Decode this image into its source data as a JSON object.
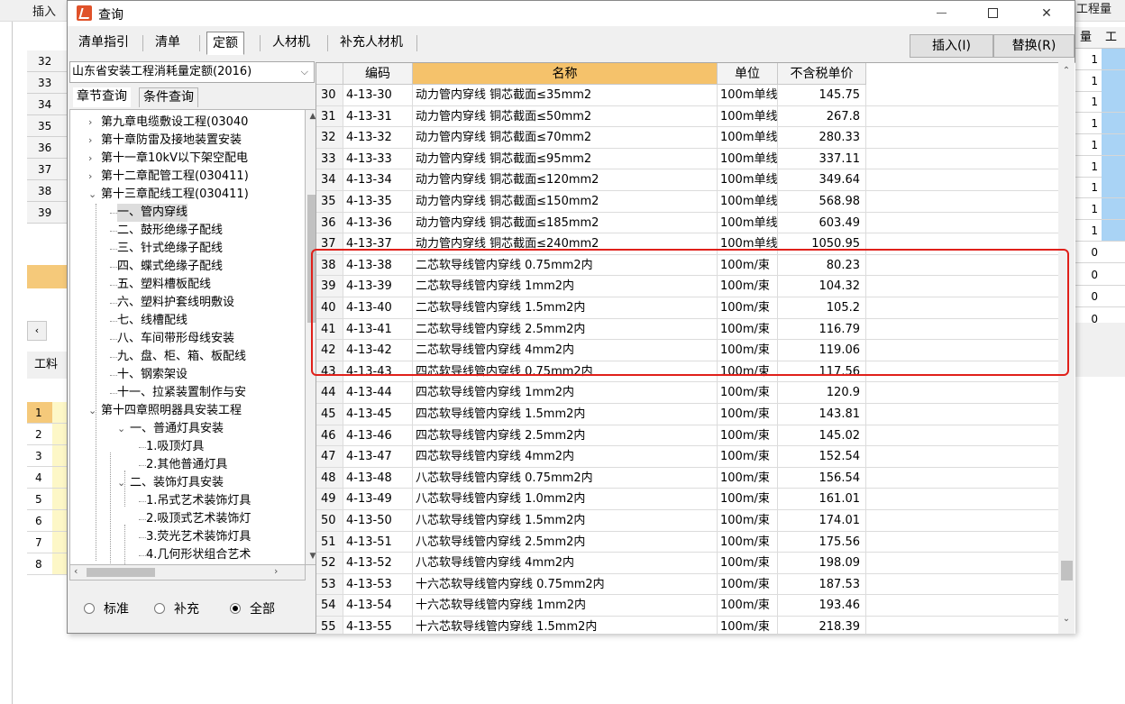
{
  "background": {
    "insert_label": "插入",
    "top_right_label": "工程量",
    "right_header": "工",
    "left_rows": [
      "32",
      "33",
      "34",
      "35",
      "36",
      "37",
      "38",
      "39"
    ],
    "gongliao_label": "工料",
    "lower_rows": [
      "1",
      "2",
      "3",
      "4",
      "5",
      "6",
      "7",
      "8"
    ],
    "right_values": [
      "1",
      "1",
      "1",
      "1",
      "1",
      "1",
      "1",
      "1",
      "1",
      "0",
      "0",
      "0",
      "0"
    ]
  },
  "dialog": {
    "title": "查询",
    "tabs": [
      "清单指引",
      "清单",
      "定额",
      "人材机",
      "补充人材机"
    ],
    "active_tab": "定额",
    "insert_button": "插入(I)",
    "replace_button": "替换(R)",
    "library_select": "山东省安装工程消耗量定额(2016)",
    "subtabs": [
      "章节查询",
      "条件查询"
    ],
    "tree": [
      {
        "label": "第九章电缆敷设工程(03040",
        "level": 1,
        "expand": "›"
      },
      {
        "label": "第十章防雷及接地装置安装",
        "level": 1,
        "expand": "›"
      },
      {
        "label": "第十一章10kV以下架空配电",
        "level": 1,
        "expand": "›"
      },
      {
        "label": "第十二章配管工程(030411)",
        "level": 1,
        "expand": "›"
      },
      {
        "label": "第十三章配线工程(030411)",
        "level": 1,
        "expand": "⌄"
      },
      {
        "label": "一、管内穿线",
        "level": 2,
        "expand": "",
        "selected": true
      },
      {
        "label": "二、鼓形绝缘子配线",
        "level": 2,
        "expand": ""
      },
      {
        "label": "三、针式绝缘子配线",
        "level": 2,
        "expand": ""
      },
      {
        "label": "四、蝶式绝缘子配线",
        "level": 2,
        "expand": ""
      },
      {
        "label": "五、塑料槽板配线",
        "level": 2,
        "expand": ""
      },
      {
        "label": "六、塑料护套线明敷设",
        "level": 2,
        "expand": ""
      },
      {
        "label": "七、线槽配线",
        "level": 2,
        "expand": ""
      },
      {
        "label": "八、车间带形母线安装",
        "level": 2,
        "expand": ""
      },
      {
        "label": "九、盘、柜、箱、板配线",
        "level": 2,
        "expand": ""
      },
      {
        "label": "十、钢索架设",
        "level": 2,
        "expand": ""
      },
      {
        "label": "十一、拉紧装置制作与安",
        "level": 2,
        "expand": ""
      },
      {
        "label": "第十四章照明器具安装工程",
        "level": 1,
        "expand": "⌄"
      },
      {
        "label": "一、普通灯具安装",
        "level": 2,
        "expand": "⌄"
      },
      {
        "label": "1.吸顶灯具",
        "level": 3,
        "expand": ""
      },
      {
        "label": "2.其他普通灯具",
        "level": 3,
        "expand": ""
      },
      {
        "label": "二、装饰灯具安装",
        "level": 2,
        "expand": "⌄"
      },
      {
        "label": "1.吊式艺术装饰灯具",
        "level": 3,
        "expand": ""
      },
      {
        "label": "2.吸顶式艺术装饰灯",
        "level": 3,
        "expand": ""
      },
      {
        "label": "3.荧光艺术装饰灯具",
        "level": 3,
        "expand": ""
      },
      {
        "label": "4.几何形状组合艺术",
        "level": 3,
        "expand": ""
      }
    ],
    "radios": [
      "标准",
      "补充",
      "全部"
    ],
    "radio_selected": "全部",
    "columns": {
      "code": "编码",
      "name": "名称",
      "unit": "单位",
      "price": "不含税单价"
    },
    "rows": [
      {
        "idx": "30",
        "code": "4-13-30",
        "name": "动力管内穿线 铜芯截面≤35mm2",
        "unit": "100m单线",
        "price": "145.75"
      },
      {
        "idx": "31",
        "code": "4-13-31",
        "name": "动力管内穿线 铜芯截面≤50mm2",
        "unit": "100m单线",
        "price": "267.8"
      },
      {
        "idx": "32",
        "code": "4-13-32",
        "name": "动力管内穿线 铜芯截面≤70mm2",
        "unit": "100m单线",
        "price": "280.33"
      },
      {
        "idx": "33",
        "code": "4-13-33",
        "name": "动力管内穿线 铜芯截面≤95mm2",
        "unit": "100m单线",
        "price": "337.11"
      },
      {
        "idx": "34",
        "code": "4-13-34",
        "name": "动力管内穿线 铜芯截面≤120mm2",
        "unit": "100m单线",
        "price": "349.64"
      },
      {
        "idx": "35",
        "code": "4-13-35",
        "name": "动力管内穿线 铜芯截面≤150mm2",
        "unit": "100m单线",
        "price": "568.98"
      },
      {
        "idx": "36",
        "code": "4-13-36",
        "name": "动力管内穿线 铜芯截面≤185mm2",
        "unit": "100m单线",
        "price": "603.49"
      },
      {
        "idx": "37",
        "code": "4-13-37",
        "name": "动力管内穿线 铜芯截面≤240mm2",
        "unit": "100m单线",
        "price": "1050.95"
      },
      {
        "idx": "38",
        "code": "4-13-38",
        "name": "二芯软导线管内穿线 0.75mm2内",
        "unit": "100m/束",
        "price": "80.23"
      },
      {
        "idx": "39",
        "code": "4-13-39",
        "name": "二芯软导线管内穿线 1mm2内",
        "unit": "100m/束",
        "price": "104.32"
      },
      {
        "idx": "40",
        "code": "4-13-40",
        "name": "二芯软导线管内穿线 1.5mm2内",
        "unit": "100m/束",
        "price": "105.2"
      },
      {
        "idx": "41",
        "code": "4-13-41",
        "name": "二芯软导线管内穿线 2.5mm2内",
        "unit": "100m/束",
        "price": "116.79"
      },
      {
        "idx": "42",
        "code": "4-13-42",
        "name": "二芯软导线管内穿线 4mm2内",
        "unit": "100m/束",
        "price": "119.06"
      },
      {
        "idx": "43",
        "code": "4-13-43",
        "name": "四芯软导线管内穿线 0.75mm2内",
        "unit": "100m/束",
        "price": "117.56"
      },
      {
        "idx": "44",
        "code": "4-13-44",
        "name": "四芯软导线管内穿线 1mm2内",
        "unit": "100m/束",
        "price": "120.9"
      },
      {
        "idx": "45",
        "code": "4-13-45",
        "name": "四芯软导线管内穿线 1.5mm2内",
        "unit": "100m/束",
        "price": "143.81"
      },
      {
        "idx": "46",
        "code": "4-13-46",
        "name": "四芯软导线管内穿线 2.5mm2内",
        "unit": "100m/束",
        "price": "145.02"
      },
      {
        "idx": "47",
        "code": "4-13-47",
        "name": "四芯软导线管内穿线 4mm2内",
        "unit": "100m/束",
        "price": "152.54"
      },
      {
        "idx": "48",
        "code": "4-13-48",
        "name": "八芯软导线管内穿线 0.75mm2内",
        "unit": "100m/束",
        "price": "156.54"
      },
      {
        "idx": "49",
        "code": "4-13-49",
        "name": "八芯软导线管内穿线 1.0mm2内",
        "unit": "100m/束",
        "price": "161.01"
      },
      {
        "idx": "50",
        "code": "4-13-50",
        "name": "八芯软导线管内穿线 1.5mm2内",
        "unit": "100m/束",
        "price": "174.01"
      },
      {
        "idx": "51",
        "code": "4-13-51",
        "name": "八芯软导线管内穿线 2.5mm2内",
        "unit": "100m/束",
        "price": "175.56"
      },
      {
        "idx": "52",
        "code": "4-13-52",
        "name": "八芯软导线管内穿线 4mm2内",
        "unit": "100m/束",
        "price": "198.09"
      },
      {
        "idx": "53",
        "code": "4-13-53",
        "name": "十六芯软导线管内穿线 0.75mm2内",
        "unit": "100m/束",
        "price": "187.53"
      },
      {
        "idx": "54",
        "code": "4-13-54",
        "name": "十六芯软导线管内穿线 1mm2内",
        "unit": "100m/束",
        "price": "193.46"
      },
      {
        "idx": "55",
        "code": "4-13-55",
        "name": "十六芯软导线管内穿线 1.5mm2内",
        "unit": "100m/束",
        "price": "218.39"
      }
    ],
    "highlight_color": "#e0201a"
  }
}
